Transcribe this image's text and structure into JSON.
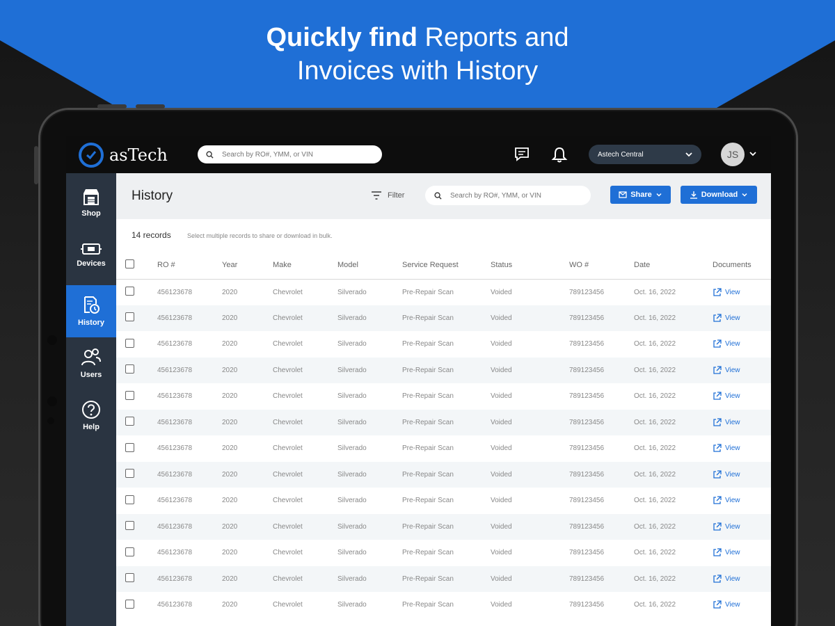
{
  "headline": {
    "bold": "Quickly find",
    "rest": " Reports and",
    "line2": "Invoices with History"
  },
  "topbar": {
    "brand": "asTech",
    "search_placeholder": "Search by RO#, YMM, or VIN",
    "org": "Astech Central",
    "avatar_initials": "JS"
  },
  "sidebar": {
    "items": [
      {
        "label": "Shop",
        "icon": "shop-icon"
      },
      {
        "label": "Devices",
        "icon": "device-icon"
      },
      {
        "label": "History",
        "icon": "history-icon",
        "active": true
      },
      {
        "label": "Users",
        "icon": "users-icon"
      },
      {
        "label": "Help",
        "icon": "help-icon"
      }
    ]
  },
  "page": {
    "title": "History",
    "filter_label": "Filter",
    "search_placeholder": "Search by RO#, YMM, or VIN",
    "share_label": "Share",
    "download_label": "Download",
    "records_count": "14 records",
    "hint": "Select multiple records to share or download in bulk."
  },
  "table": {
    "columns": [
      "RO #",
      "Year",
      "Make",
      "Model",
      "Service Request",
      "Status",
      "WO #",
      "Date",
      "Documents"
    ],
    "rows": [
      {
        "ro": "456123678",
        "year": "2020",
        "make": "Chevrolet",
        "model": "Silverado",
        "service": "Pre-Repair Scan",
        "status": "Voided",
        "wo": "789123456",
        "date": "Oct. 16, 2022",
        "doc": "View"
      },
      {
        "ro": "456123678",
        "year": "2020",
        "make": "Chevrolet",
        "model": "Silverado",
        "service": "Pre-Repair Scan",
        "status": "Voided",
        "wo": "789123456",
        "date": "Oct. 16, 2022",
        "doc": "View"
      },
      {
        "ro": "456123678",
        "year": "2020",
        "make": "Chevrolet",
        "model": "Silverado",
        "service": "Pre-Repair Scan",
        "status": "Voided",
        "wo": "789123456",
        "date": "Oct. 16, 2022",
        "doc": "View"
      },
      {
        "ro": "456123678",
        "year": "2020",
        "make": "Chevrolet",
        "model": "Silverado",
        "service": "Pre-Repair Scan",
        "status": "Voided",
        "wo": "789123456",
        "date": "Oct. 16, 2022",
        "doc": "View"
      },
      {
        "ro": "456123678",
        "year": "2020",
        "make": "Chevrolet",
        "model": "Silverado",
        "service": "Pre-Repair Scan",
        "status": "Voided",
        "wo": "789123456",
        "date": "Oct. 16, 2022",
        "doc": "View"
      },
      {
        "ro": "456123678",
        "year": "2020",
        "make": "Chevrolet",
        "model": "Silverado",
        "service": "Pre-Repair Scan",
        "status": "Voided",
        "wo": "789123456",
        "date": "Oct. 16, 2022",
        "doc": "View"
      },
      {
        "ro": "456123678",
        "year": "2020",
        "make": "Chevrolet",
        "model": "Silverado",
        "service": "Pre-Repair Scan",
        "status": "Voided",
        "wo": "789123456",
        "date": "Oct. 16, 2022",
        "doc": "View"
      },
      {
        "ro": "456123678",
        "year": "2020",
        "make": "Chevrolet",
        "model": "Silverado",
        "service": "Pre-Repair Scan",
        "status": "Voided",
        "wo": "789123456",
        "date": "Oct. 16, 2022",
        "doc": "View"
      },
      {
        "ro": "456123678",
        "year": "2020",
        "make": "Chevrolet",
        "model": "Silverado",
        "service": "Pre-Repair Scan",
        "status": "Voided",
        "wo": "789123456",
        "date": "Oct. 16, 2022",
        "doc": "View"
      },
      {
        "ro": "456123678",
        "year": "2020",
        "make": "Chevrolet",
        "model": "Silverado",
        "service": "Pre-Repair Scan",
        "status": "Voided",
        "wo": "789123456",
        "date": "Oct. 16, 2022",
        "doc": "View"
      },
      {
        "ro": "456123678",
        "year": "2020",
        "make": "Chevrolet",
        "model": "Silverado",
        "service": "Pre-Repair Scan",
        "status": "Voided",
        "wo": "789123456",
        "date": "Oct. 16, 2022",
        "doc": "View"
      },
      {
        "ro": "456123678",
        "year": "2020",
        "make": "Chevrolet",
        "model": "Silverado",
        "service": "Pre-Repair Scan",
        "status": "Voided",
        "wo": "789123456",
        "date": "Oct. 16, 2022",
        "doc": "View"
      },
      {
        "ro": "456123678",
        "year": "2020",
        "make": "Chevrolet",
        "model": "Silverado",
        "service": "Pre-Repair Scan",
        "status": "Voided",
        "wo": "789123456",
        "date": "Oct. 16, 2022",
        "doc": "View"
      }
    ]
  },
  "colors": {
    "accent": "#1f6fd6",
    "topbar": "#0d0d0d",
    "sidebar": "#2a3441"
  }
}
